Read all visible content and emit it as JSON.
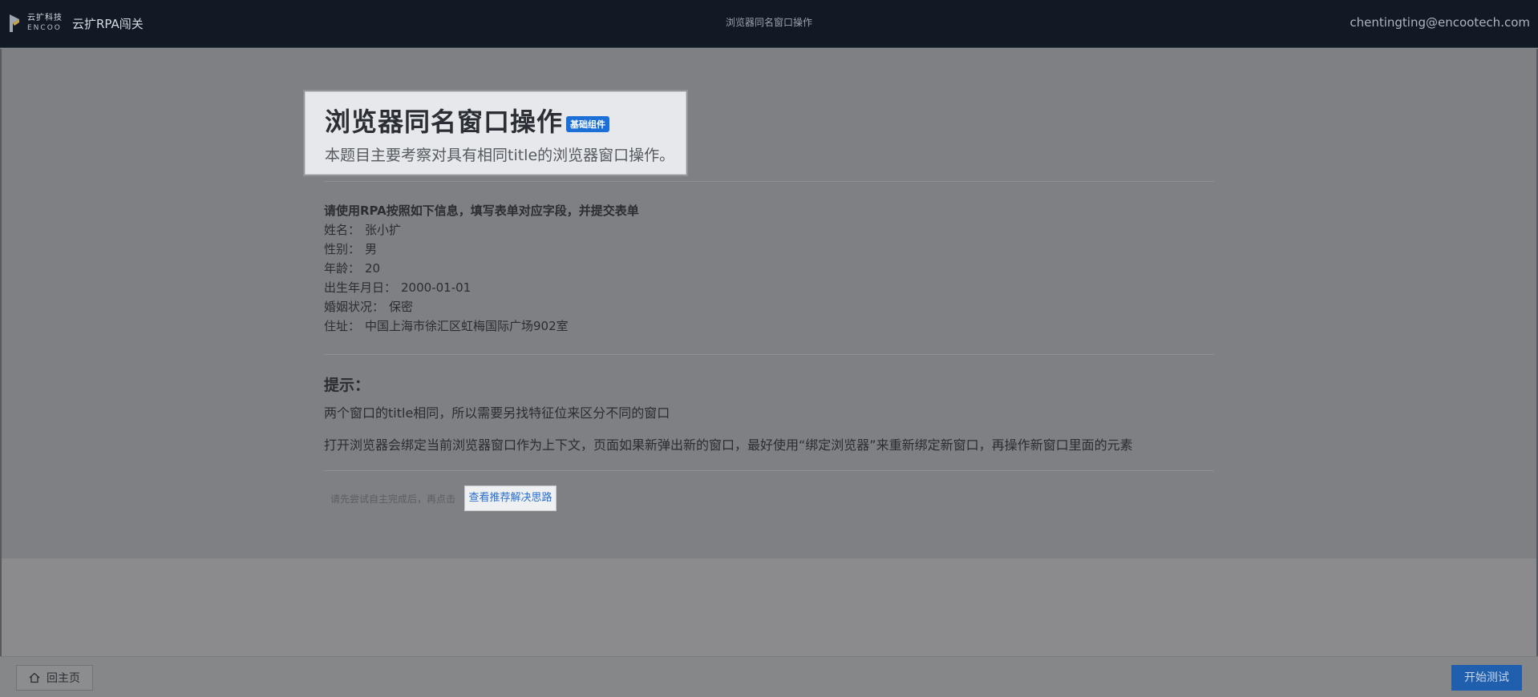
{
  "header": {
    "brand_cn": "云扩科技",
    "brand_en": "ENCOO",
    "app_name": "云扩RPA闯关",
    "page_title": "浏览器同名窗口操作",
    "user_email": "chentingting@encootech.com"
  },
  "hero": {
    "title": "浏览器同名窗口操作",
    "badge": "基础组件",
    "subtitle": "本题目主要考察对具有相同title的浏览器窗口操作。"
  },
  "info": {
    "lead": "请使用RPA按照如下信息，填写表单对应字段，并提交表单",
    "fields": [
      {
        "label": "姓名：",
        "value": "张小扩"
      },
      {
        "label": "性别：",
        "value": "男"
      },
      {
        "label": "年龄：",
        "value": "20"
      },
      {
        "label": "出生年月日：",
        "value": "2000-01-01"
      },
      {
        "label": "婚姻状况：",
        "value": "保密"
      },
      {
        "label": "住址：",
        "value": "中国上海市徐汇区虹梅国际广场902室"
      }
    ]
  },
  "tips": {
    "title": "提示：",
    "items": [
      "两个窗口的title相同，所以需要另找特征位来区分不同的窗口",
      "打开浏览器会绑定当前浏览器窗口作为上下文，页面如果新弹出新的窗口，最好使用“绑定浏览器”来重新绑定新窗口，再操作新窗口里面的元素"
    ]
  },
  "hint": {
    "text": "请先尝试自主完成后，再点击",
    "link": "查看推荐解决思路"
  },
  "footer": {
    "home_label": "回主页",
    "start_label": "开始测试"
  },
  "colors": {
    "badge": "#1c6fd6",
    "primary_button": "#1f5fae",
    "link": "#2a6ecf"
  }
}
